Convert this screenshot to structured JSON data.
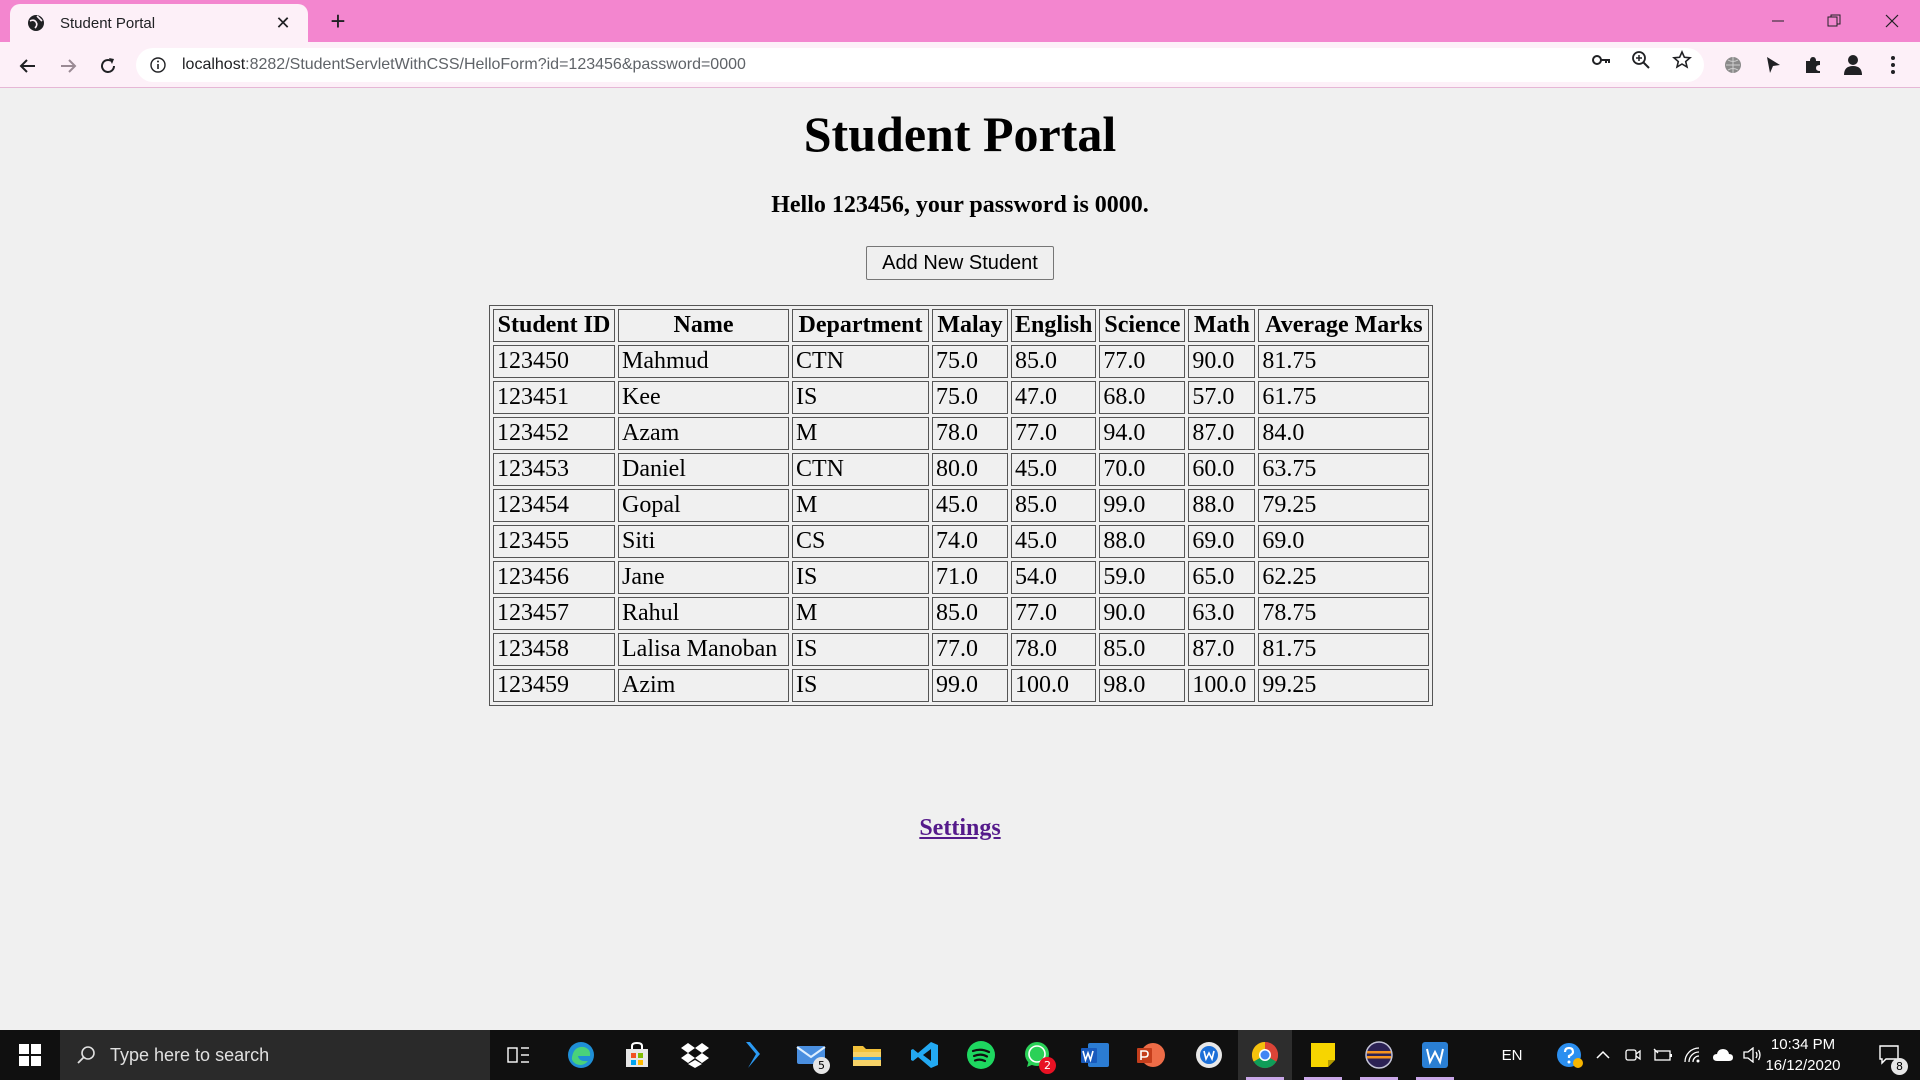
{
  "browser": {
    "tab_title": "Student Portal",
    "url_host": "localhost",
    "url_rest": ":8282/StudentServletWithCSS/HelloForm?id=123456&password=0000"
  },
  "page": {
    "title": "Student Portal",
    "greeting": "Hello 123456, your password is 0000.",
    "add_button": "Add New Student",
    "settings_link": "Settings"
  },
  "table": {
    "headers": [
      "Student ID",
      "Name",
      "Department",
      "Malay",
      "English",
      "Science",
      "Math",
      "Average Marks"
    ],
    "rows": [
      [
        "123450",
        "Mahmud",
        "CTN",
        "75.0",
        "85.0",
        "77.0",
        "90.0",
        "81.75"
      ],
      [
        "123451",
        "Kee",
        "IS",
        "75.0",
        "47.0",
        "68.0",
        "57.0",
        "61.75"
      ],
      [
        "123452",
        "Azam",
        "M",
        "78.0",
        "77.0",
        "94.0",
        "87.0",
        "84.0"
      ],
      [
        "123453",
        "Daniel",
        "CTN",
        "80.0",
        "45.0",
        "70.0",
        "60.0",
        "63.75"
      ],
      [
        "123454",
        "Gopal",
        "M",
        "45.0",
        "85.0",
        "99.0",
        "88.0",
        "79.25"
      ],
      [
        "123455",
        "Siti",
        "CS",
        "74.0",
        "45.0",
        "88.0",
        "69.0",
        "69.0"
      ],
      [
        "123456",
        "Jane",
        "IS",
        "71.0",
        "54.0",
        "59.0",
        "65.0",
        "62.25"
      ],
      [
        "123457",
        "Rahul",
        "M",
        "85.0",
        "77.0",
        "90.0",
        "63.0",
        "78.75"
      ],
      [
        "123458",
        "Lalisa Manoban",
        "IS",
        "77.0",
        "78.0",
        "85.0",
        "87.0",
        "81.75"
      ],
      [
        "123459",
        "Azim",
        "IS",
        "99.0",
        "100.0",
        "98.0",
        "100.0",
        "99.25"
      ]
    ]
  },
  "taskbar": {
    "search_placeholder": "Type here to search",
    "mail_badge": "5",
    "whatsapp_badge": "2",
    "language": "EN",
    "time": "10:34 PM",
    "date": "16/12/2020",
    "notification_count": "8"
  },
  "colors": {
    "tab_strip": "#f386cf",
    "toolbar": "#fdf0f8",
    "link_visited": "#551a8b",
    "taskbar": "#101010"
  }
}
